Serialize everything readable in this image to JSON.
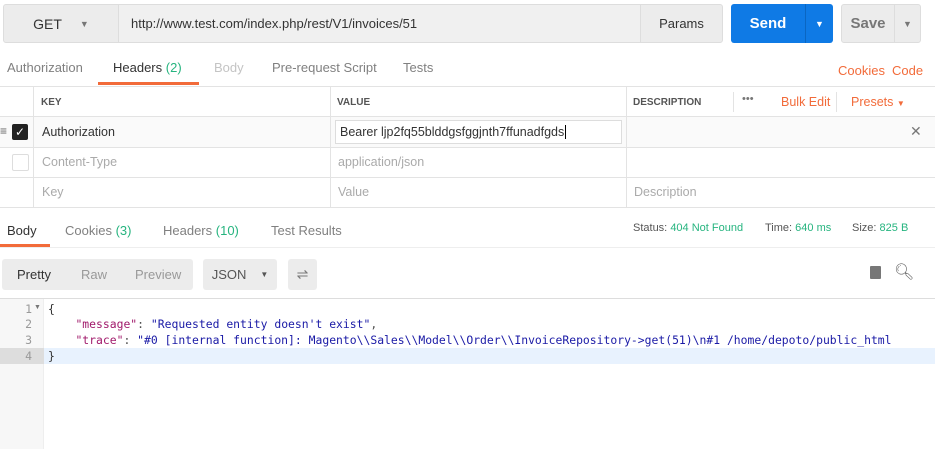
{
  "request": {
    "method": "GET",
    "url": "http://www.test.com/index.php/rest/V1/invoices/51",
    "params_label": "Params",
    "send_label": "Send",
    "save_label": "Save"
  },
  "request_tabs": [
    {
      "label": "Authorization"
    },
    {
      "label": "Headers",
      "count": "(2)"
    },
    {
      "label": "Body"
    },
    {
      "label": "Pre-request Script"
    },
    {
      "label": "Tests"
    }
  ],
  "links": {
    "cookies": "Cookies",
    "code": "Code"
  },
  "headers_table": {
    "columns": [
      "KEY",
      "VALUE",
      "DESCRIPTION"
    ],
    "more": "•••",
    "bulk_edit": "Bulk Edit",
    "presets": "Presets",
    "rows": [
      {
        "key": "Authorization",
        "value": "Bearer ljp2fq55blddgsfggjnth7ffunadfgds",
        "checked": true
      },
      {
        "key": "Content-Type",
        "value": "application/json",
        "checked": false
      }
    ],
    "placeholders": {
      "key": "Key",
      "value": "Value",
      "description": "Description"
    }
  },
  "response_tabs": [
    {
      "label": "Body"
    },
    {
      "label": "Cookies",
      "count": "(3)"
    },
    {
      "label": "Headers",
      "count": "(10)"
    },
    {
      "label": "Test Results"
    }
  ],
  "status": {
    "status_label": "Status:",
    "status": "404 Not Found",
    "time_label": "Time:",
    "time": "640 ms",
    "size_label": "Size:",
    "size": "825 B"
  },
  "view": {
    "pretty": "Pretty",
    "raw": "Raw",
    "preview": "Preview",
    "format": "JSON"
  },
  "code": {
    "line_numbers": [
      "1",
      "2",
      "3",
      "4"
    ],
    "open": "{",
    "k1": "\"message\"",
    "v1": "\"Requested entity doesn't exist\"",
    "k2": "\"trace\"",
    "v2": "\"#0 [internal function]: Magento\\\\Sales\\\\Model\\\\Order\\\\InvoiceRepository->get(51)\\n#1 /home/depoto/public_html",
    "close": "}"
  }
}
